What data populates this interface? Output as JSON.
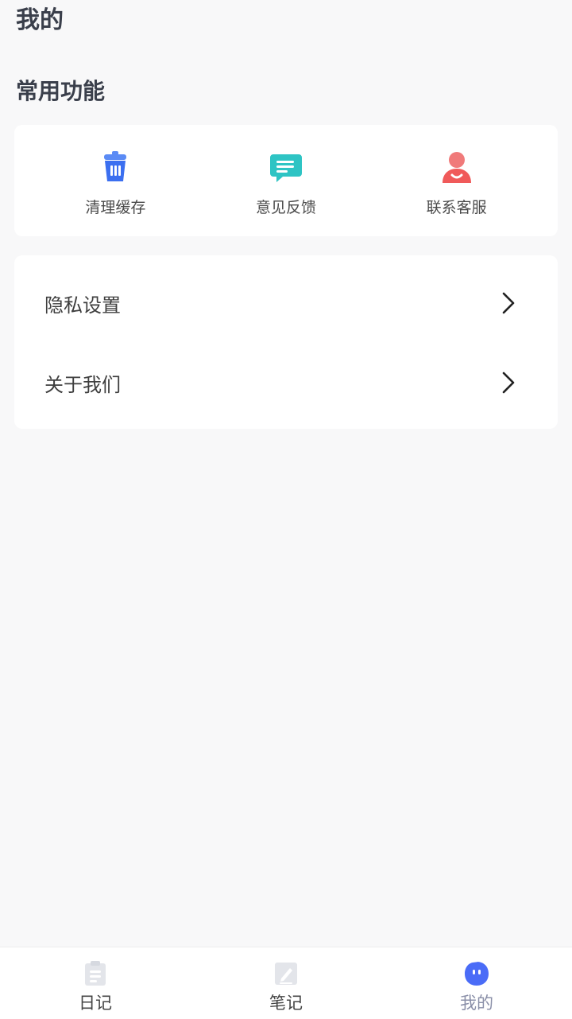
{
  "header": {
    "title": "我的"
  },
  "section": {
    "title": "常用功能"
  },
  "quick_actions": [
    {
      "label": "清理缓存",
      "icon": "trash-icon",
      "color": "#3b6ff0"
    },
    {
      "label": "意见反馈",
      "icon": "feedback-icon",
      "color": "#2ec4c4"
    },
    {
      "label": "联系客服",
      "icon": "customer-service-icon",
      "color": "#f05a5a"
    }
  ],
  "settings_list": [
    {
      "label": "隐私设置"
    },
    {
      "label": "关于我们"
    }
  ],
  "tabbar": {
    "tabs": [
      {
        "label": "日记",
        "icon": "diary-icon",
        "active": false
      },
      {
        "label": "笔记",
        "icon": "note-icon",
        "active": false
      },
      {
        "label": "我的",
        "icon": "profile-icon",
        "active": true
      }
    ],
    "active_color": "#4a6cf7",
    "inactive_color": "#e3e5ea"
  }
}
